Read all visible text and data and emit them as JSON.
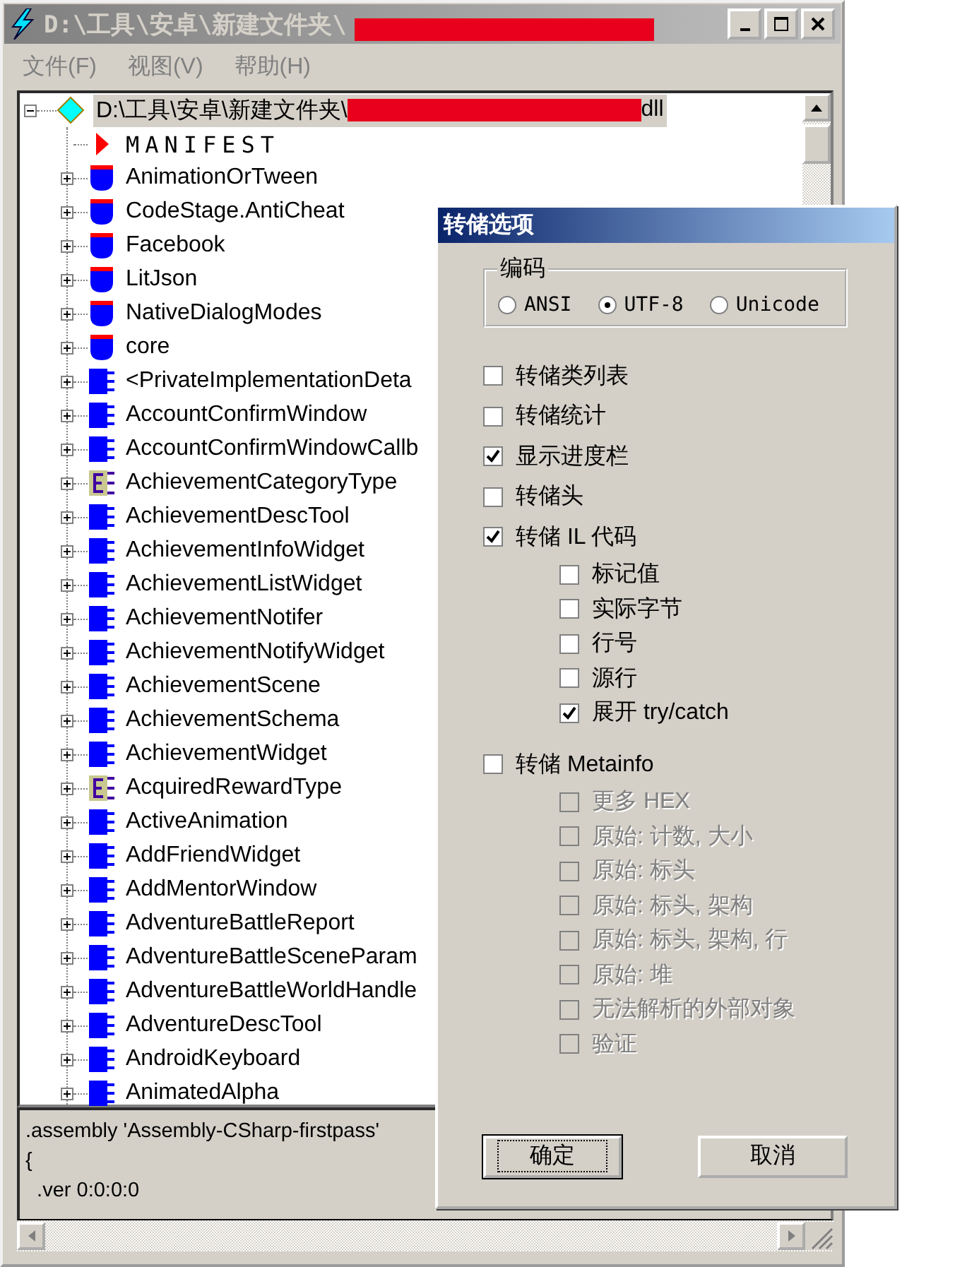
{
  "window": {
    "title": "D:\\工具\\安卓\\新建文件夹\\",
    "title_redacted": true
  },
  "menu": [
    "文件(F)",
    "视图(V)",
    "帮助(H)"
  ],
  "tree": {
    "label": "D:\\工具\\安卓\\新建文件夹\\",
    "suffix": "dll",
    "redacted": true,
    "kind": "assembly",
    "expanded": true,
    "selected": true,
    "children": [
      {
        "label": "MANIFEST",
        "kind": "manifest",
        "selected": false
      },
      {
        "label": "AnimationOrTween",
        "kind": "namespace",
        "expanded": false,
        "selected": false
      },
      {
        "label": "CodeStage.AntiCheat",
        "kind": "namespace",
        "expanded": false,
        "selected": false
      },
      {
        "label": "Facebook",
        "kind": "namespace",
        "expanded": false,
        "selected": false
      },
      {
        "label": "LitJson",
        "kind": "namespace",
        "expanded": false,
        "selected": false
      },
      {
        "label": "NativeDialogModes",
        "kind": "namespace",
        "expanded": false,
        "selected": false
      },
      {
        "label": "core",
        "kind": "namespace",
        "expanded": false,
        "selected": false
      },
      {
        "label": "<PrivateImplementationDeta",
        "kind": "class",
        "expanded": false,
        "selected": false
      },
      {
        "label": "AccountConfirmWindow",
        "kind": "class",
        "expanded": false,
        "selected": false
      },
      {
        "label": "AccountConfirmWindowCallb",
        "kind": "class",
        "expanded": false,
        "selected": false
      },
      {
        "label": "AchievementCategoryType",
        "kind": "enum",
        "expanded": false,
        "selected": false
      },
      {
        "label": "AchievementDescTool",
        "kind": "class",
        "expanded": false,
        "selected": false
      },
      {
        "label": "AchievementInfoWidget",
        "kind": "class",
        "expanded": false,
        "selected": false
      },
      {
        "label": "AchievementListWidget",
        "kind": "class",
        "expanded": false,
        "selected": false
      },
      {
        "label": "AchievementNotifer",
        "kind": "class",
        "expanded": false,
        "selected": false
      },
      {
        "label": "AchievementNotifyWidget",
        "kind": "class",
        "expanded": false,
        "selected": false
      },
      {
        "label": "AchievementScene",
        "kind": "class",
        "expanded": false,
        "selected": false
      },
      {
        "label": "AchievementSchema",
        "kind": "class",
        "expanded": false,
        "selected": false
      },
      {
        "label": "AchievementWidget",
        "kind": "class",
        "expanded": false,
        "selected": false
      },
      {
        "label": "AcquiredRewardType",
        "kind": "enum",
        "expanded": false,
        "selected": false
      },
      {
        "label": "ActiveAnimation",
        "kind": "class",
        "expanded": false,
        "selected": false
      },
      {
        "label": "AddFriendWidget",
        "kind": "class",
        "expanded": false,
        "selected": false
      },
      {
        "label": "AddMentorWindow",
        "kind": "class",
        "expanded": false,
        "selected": false
      },
      {
        "label": "AdventureBattleReport",
        "kind": "class",
        "expanded": false,
        "selected": false
      },
      {
        "label": "AdventureBattleSceneParam",
        "kind": "class",
        "expanded": false,
        "selected": false
      },
      {
        "label": "AdventureBattleWorldHandle",
        "kind": "class",
        "expanded": false,
        "selected": false
      },
      {
        "label": "AdventureDescTool",
        "kind": "class",
        "expanded": false,
        "selected": false
      },
      {
        "label": "AndroidKeyboard",
        "kind": "class",
        "expanded": false,
        "selected": false
      },
      {
        "label": "AnimatedAlpha",
        "kind": "class",
        "expanded": false,
        "selected": false
      }
    ]
  },
  "details": [
    ".assembly 'Assembly-CSharp-firstpass'",
    "{",
    "  .ver 0:0:0:0"
  ],
  "dialog": {
    "title": "转储选项",
    "encoding": {
      "label": "编码",
      "options": [
        {
          "label": "ANSI",
          "selected": false
        },
        {
          "label": "UTF-8",
          "selected": true
        },
        {
          "label": "Unicode",
          "selected": false
        }
      ]
    },
    "options": [
      {
        "label": "转储类列表",
        "checked": false,
        "disabled": false
      },
      {
        "label": "转储统计",
        "checked": false,
        "disabled": false
      },
      {
        "label": "显示进度栏",
        "checked": true,
        "disabled": false
      },
      {
        "label": "转储头",
        "checked": false,
        "disabled": false
      },
      {
        "label": "转储 IL 代码",
        "checked": true,
        "disabled": false,
        "children": [
          {
            "label": "标记值",
            "checked": false,
            "disabled": false
          },
          {
            "label": "实际字节",
            "checked": false,
            "disabled": false
          },
          {
            "label": "行号",
            "checked": false,
            "disabled": false
          },
          {
            "label": "源行",
            "checked": false,
            "disabled": false
          },
          {
            "label": "展开 try/catch",
            "checked": true,
            "disabled": false
          }
        ]
      },
      {
        "label": "转储 Metainfo",
        "checked": false,
        "disabled": false,
        "children": [
          {
            "label": "更多 HEX",
            "checked": false,
            "disabled": true
          },
          {
            "label": "原始: 计数, 大小",
            "checked": false,
            "disabled": true
          },
          {
            "label": "原始: 标头",
            "checked": false,
            "disabled": true
          },
          {
            "label": "原始: 标头, 架构",
            "checked": false,
            "disabled": true
          },
          {
            "label": "原始: 标头, 架构, 行",
            "checked": false,
            "disabled": true
          },
          {
            "label": "原始: 堆",
            "checked": false,
            "disabled": true
          },
          {
            "label": "无法解析的外部对象",
            "checked": false,
            "disabled": true
          },
          {
            "label": "验证",
            "checked": false,
            "disabled": true
          }
        ]
      }
    ],
    "buttons": [
      {
        "label": "确定",
        "default": true
      },
      {
        "label": "取消",
        "default": false
      }
    ]
  }
}
